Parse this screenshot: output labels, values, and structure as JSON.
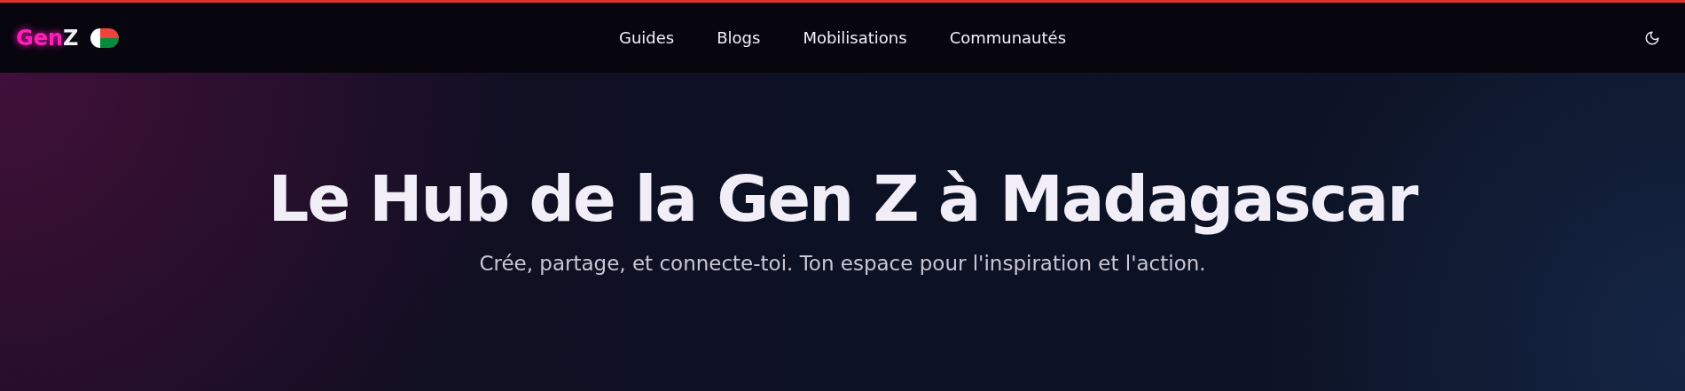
{
  "logo": {
    "accent": "Gen",
    "rest": "Z"
  },
  "nav": [
    {
      "label": "Guides"
    },
    {
      "label": "Blogs"
    },
    {
      "label": "Mobilisations"
    },
    {
      "label": "Communautés"
    }
  ],
  "hero": {
    "title": "Le Hub de la Gen Z à Madagascar",
    "subtitle": "Crée, partage, et connecte-toi. Ton espace pour l'inspiration et l'action."
  }
}
